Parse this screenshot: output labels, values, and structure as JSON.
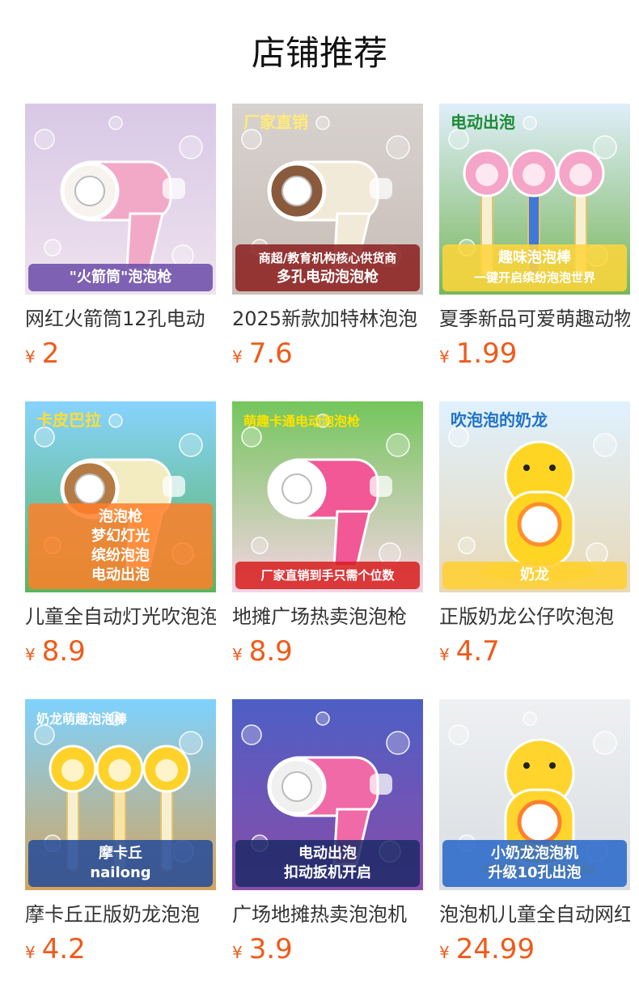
{
  "header": {
    "title": "店铺推荐"
  },
  "currency_symbol": "¥",
  "products": [
    {
      "name": "网红火箭筒12孔电动",
      "price": "2",
      "icon": "pink-rocket-bubble-gun-image",
      "badge_top": "",
      "badge_lines": [
        "\"火箭筒\"泡泡枪"
      ],
      "colors": {
        "bg1": "#d8c8e6",
        "bg2": "#efe2ee",
        "main": "#f2a9c8",
        "accent": "#f7f3ef",
        "text": "#ffffff",
        "banner": "#6b4ca8"
      }
    },
    {
      "name": "2025新款加特林泡泡",
      "price": "7.6",
      "icon": "cream-bubble-gun-image",
      "badge_top": "厂家直销",
      "badge_lines": [
        "商超/教育机构核心供货商",
        "多孔电动泡泡枪"
      ],
      "colors": {
        "bg1": "#d7d2cf",
        "bg2": "#c9bdb6",
        "main": "#f2ead8",
        "accent": "#8a5a3d",
        "text": "#ffeb78",
        "banner": "#8b1e1e"
      }
    },
    {
      "name": "夏季新品可爱萌趣动物",
      "price": "1.99",
      "icon": "animal-bubble-wands-image",
      "badge_top": "电动出泡",
      "badge_lines": [
        "趣味泡泡棒",
        "一键开启缤纷泡泡世界"
      ],
      "colors": {
        "bg1": "#dfeefa",
        "bg2": "#78b65b",
        "main": "#f5a5c8",
        "accent": "#3f78d8",
        "text": "#1d8a36",
        "banner": "#ffd53a"
      }
    },
    {
      "name": "儿童全自动灯光吹泡泡",
      "price": "8.9",
      "icon": "capybara-bubble-gun-image",
      "badge_top": "卡皮巴拉",
      "badge_lines": [
        "泡泡枪",
        "梦幻灯光",
        "缤纷泡泡",
        "电动出泡"
      ],
      "colors": {
        "bg1": "#87d3ff",
        "bg2": "#59b55c",
        "main": "#f3ecc0",
        "accent": "#b57b44",
        "text": "#ffdd36",
        "banner": "#ff7f2a"
      }
    },
    {
      "name": "地摊广场热卖泡泡枪",
      "price": "8.9",
      "icon": "pink-cartoon-bubble-gun-image",
      "badge_top": "萌趣卡通电动泡泡枪",
      "badge_lines": [
        "厂家直销到手只需个位数"
      ],
      "colors": {
        "bg1": "#74c65c",
        "bg2": "#f7d4e6",
        "main": "#f15895",
        "accent": "#ffffff",
        "text": "#ffe100",
        "banner": "#d71e1e"
      }
    },
    {
      "name": "正版奶龙公仔吹泡泡",
      "price": "4.7",
      "icon": "yellow-dragon-bubble-machine-image",
      "badge_top": "吹泡泡的奶龙",
      "badge_lines": [
        "奶龙"
      ],
      "colors": {
        "bg1": "#dff1ff",
        "bg2": "#e8d8b5",
        "main": "#ffd524",
        "accent": "#ff8f2b",
        "text": "#1f72c7",
        "banner": "#ffcf2e"
      }
    },
    {
      "name": "摩卡丘正版奶龙泡泡",
      "price": "4.2",
      "icon": "dragon-bubble-wands-image",
      "badge_top": "奶龙萌趣泡泡棒",
      "badge_lines": [
        "摩卡丘",
        "nailong"
      ],
      "colors": {
        "bg1": "#7ed2ff",
        "bg2": "#d4a45d",
        "main": "#ffd22a",
        "accent": "#f9e4a7",
        "text": "#ffffff",
        "banner": "#234a9a"
      }
    },
    {
      "name": "广场地摊热卖泡泡机",
      "price": "3.9",
      "icon": "pink-electric-bubble-gun-image",
      "badge_top": "",
      "badge_lines": [
        "电动出泡",
        "扣动扳机开启"
      ],
      "colors": {
        "bg1": "#4d5fc5",
        "bg2": "#8a4da9",
        "main": "#f06aa7",
        "accent": "#f0f0f0",
        "text": "#ffffff",
        "banner": "#1d2a68"
      }
    },
    {
      "name": "泡泡机儿童全自动网红",
      "price": "24.99",
      "icon": "little-dragon-bubble-machine-image",
      "badge_top": "",
      "badge_lines": [
        "小奶龙泡泡机",
        "升级10孔出泡"
      ],
      "colors": {
        "bg1": "#eef0f2",
        "bg2": "#d9dde1",
        "main": "#ffd52d",
        "accent": "#ff7f2d",
        "text": "#ff4e2d",
        "banner": "#2667c9"
      }
    }
  ]
}
